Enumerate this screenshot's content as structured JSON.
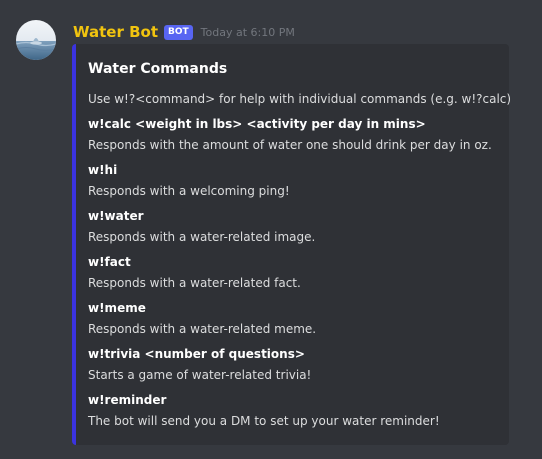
{
  "message": {
    "username": "Water Bot",
    "bot_tag": "BOT",
    "timestamp": "Today at 6:10 PM",
    "avatar_icon": "water-drop-avatar-icon"
  },
  "embed": {
    "accent_color": "#3b33e0",
    "title": "Water Commands",
    "description": "Use w!?<command> for help with individual commands (e.g. w!?calc)",
    "fields": [
      {
        "name": "w!calc <weight in lbs> <activity per day in mins>",
        "value": "Responds with the amount of water one should drink per day in oz."
      },
      {
        "name": "w!hi",
        "value": "Responds with a welcoming ping!"
      },
      {
        "name": "w!water",
        "value": "Responds with a water-related image."
      },
      {
        "name": "w!fact",
        "value": "Responds with a water-related fact."
      },
      {
        "name": "w!meme",
        "value": "Responds with a water-related meme."
      },
      {
        "name": "w!trivia <number of questions>",
        "value": "Starts a game of water-related trivia!"
      },
      {
        "name": "w!reminder",
        "value": "The bot will send you a DM to set up your water reminder!"
      }
    ]
  },
  "colors": {
    "background": "#36393f",
    "embed_background": "#2f3136",
    "username": "#f1c40f",
    "bot_tag": "#5865f2"
  }
}
